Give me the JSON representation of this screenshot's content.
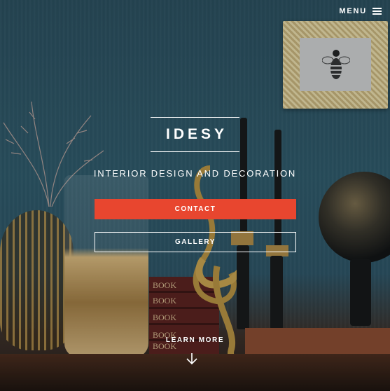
{
  "nav": {
    "menu_label": "MENU",
    "menu_icon": "hamburger-icon"
  },
  "hero": {
    "title": "IDESY",
    "tagline": "INTERIOR DESIGN AND DECORATION",
    "contact_label": "CONTACT",
    "gallery_label": "GALLERY",
    "learn_more_label": "LEARN MORE",
    "scroll_icon": "arrow-down-icon"
  },
  "background": {
    "books": [
      "BOOK",
      "BOOK",
      "BOOK",
      "BOOK",
      "BOOK"
    ]
  },
  "colors": {
    "accent": "#e8462f",
    "text": "#ffffff",
    "wall": "#2e5868"
  }
}
